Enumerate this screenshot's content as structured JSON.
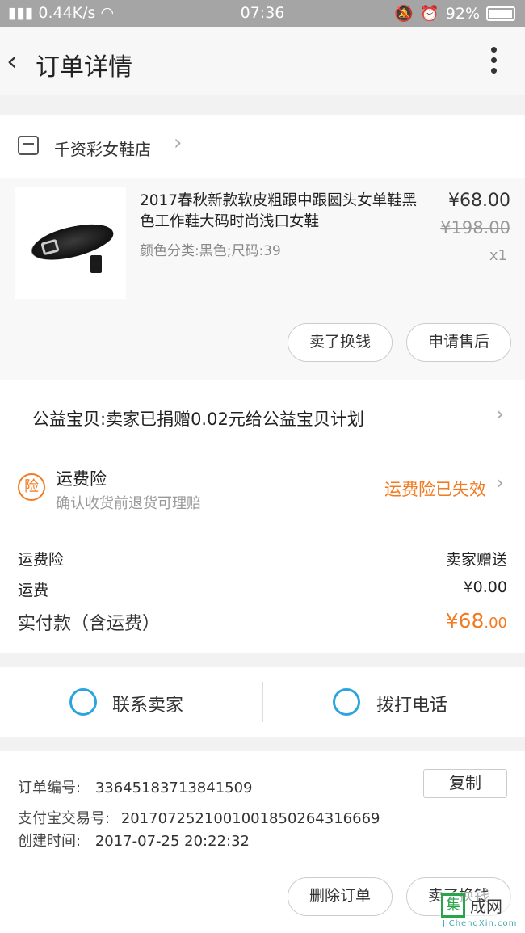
{
  "status_bar": {
    "network": "0.44K/s",
    "time": "07:36",
    "battery": "92%"
  },
  "header": {
    "title": "订单详情"
  },
  "shop": {
    "name": "千资彩女鞋店"
  },
  "product": {
    "title": "2017春秋新款软皮粗跟中跟圆头女单鞋黑色工作鞋大码时尚浅口女鞋",
    "spec": "颜色分类:黑色;尺码:39",
    "price": "¥68.00",
    "original_price": "¥198.00",
    "quantity": "x1",
    "actions": [
      "卖了换钱",
      "申请售后"
    ]
  },
  "charity": {
    "text": "公益宝贝:卖家已捐赠0.02元给公益宝贝计划"
  },
  "insurance": {
    "icon_text": "险",
    "title": "运费险",
    "subtitle": "确认收货前退货可理赔",
    "status": "运费险已失效"
  },
  "fees": {
    "rows": [
      {
        "label": "运费险",
        "value": "卖家赠送"
      },
      {
        "label": "运费",
        "value": "¥0.00"
      }
    ],
    "total_label": "实付款（含运费）",
    "total_currency": "¥",
    "total_int": "68",
    "total_dec": ".00"
  },
  "contact": {
    "seller": "联系卖家",
    "phone": "拨打电话"
  },
  "order": {
    "number_label": "订单编号:",
    "number": "33645183713841509",
    "copy_label": "复制",
    "alipay_label": "支付宝交易号:",
    "alipay": "2017072521001001850264316669",
    "created_label": "创建时间:",
    "created": "2017-07-25 20:22:32"
  },
  "bottom_actions": [
    "删除订单",
    "卖了换钱"
  ],
  "watermark": {
    "char": "集",
    "name": "成网",
    "site": "JiChengXin.com"
  },
  "colors": {
    "accent": "#f27a21",
    "contact_icon": "#2ba4e0"
  }
}
